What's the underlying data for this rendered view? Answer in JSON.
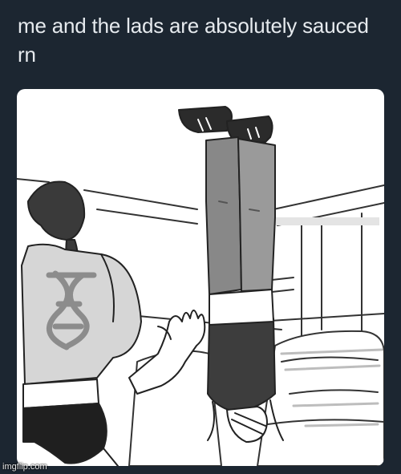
{
  "post": {
    "caption": "me and the lads are absolutely sauced rn"
  },
  "drawing": {
    "shirt_emblem_icon": "dna-helix-icon"
  },
  "watermark": {
    "text": "imgflip.com"
  },
  "colors": {
    "background": "#1c2631",
    "caption_text": "#e6eaee",
    "card": "#ffffff",
    "ink": "#222222",
    "grey_light": "#d8d8d8",
    "grey_mid": "#9c9c9c",
    "grey_dark": "#4a4a4a"
  }
}
